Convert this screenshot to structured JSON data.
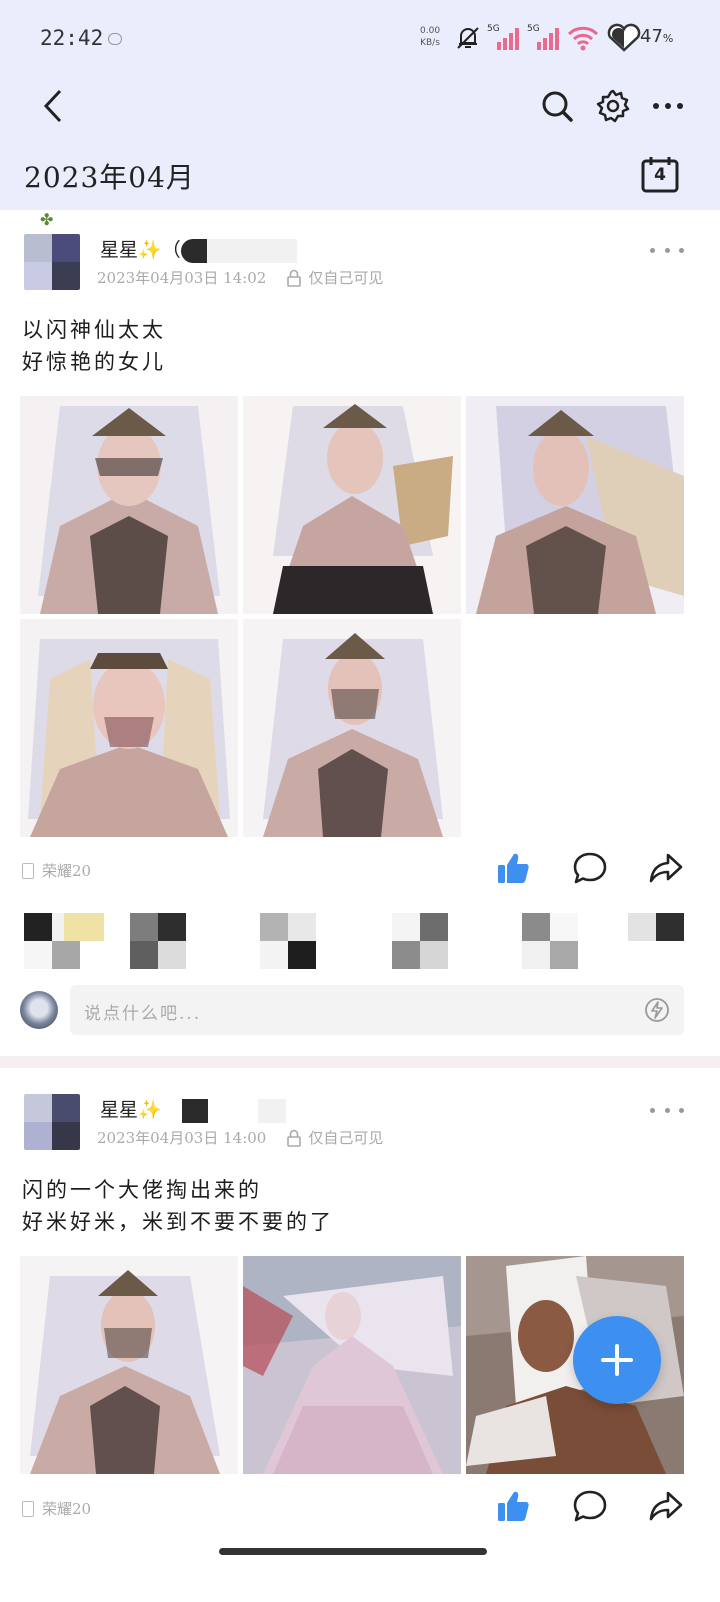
{
  "status_bar": {
    "time": "22:42",
    "net_speed_value": "0.00",
    "net_speed_unit": "KB/s",
    "signal1_label": "5G",
    "signal2_label": "5G",
    "battery_percent": "47",
    "battery_unit": "%"
  },
  "header": {
    "back_icon": "chevron-left-icon",
    "search_icon": "search-icon",
    "settings_icon": "gear-icon",
    "more_icon": "more-horizontal-icon"
  },
  "month_bar": {
    "title": "2023年04月",
    "calendar_day": "4"
  },
  "posts": [
    {
      "username": "星星",
      "username_suffix": "✨",
      "paren": "（",
      "date": "2023年04月03日 14:02",
      "privacy": "仅自己可见",
      "text": "以闪神仙太太\n好惊艳的女儿",
      "device": "荣耀20",
      "comment_placeholder": "说点什么吧..."
    },
    {
      "username": "星星",
      "username_suffix": "✨",
      "date": "2023年04月03日 14:00",
      "privacy": "仅自己可见",
      "text": "  闪的一个大佬掏出来的\n好米好米，米到不要不要的了",
      "device": "荣耀20"
    }
  ],
  "colors": {
    "header_bg": "#eaedfb",
    "accent_blue": "#3d8ff0",
    "signal_pink": "#e86a8e"
  }
}
